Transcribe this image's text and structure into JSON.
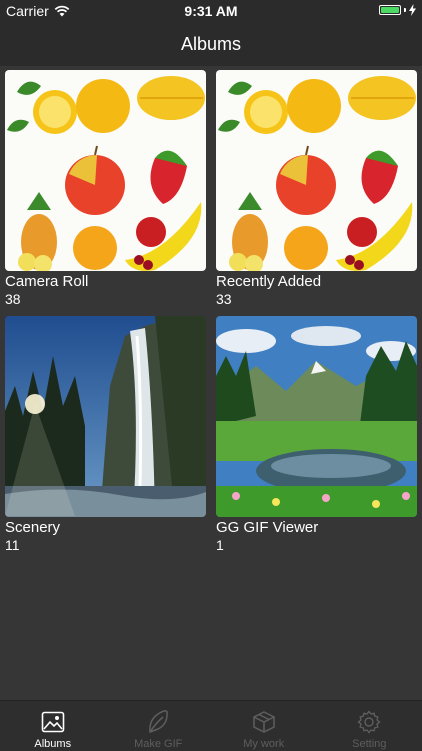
{
  "status_bar": {
    "carrier": "Carrier",
    "time": "9:31 AM"
  },
  "nav": {
    "title": "Albums"
  },
  "albums": [
    {
      "name": "Camera Roll",
      "count": "38",
      "thumb": "fruit-collage"
    },
    {
      "name": "Recently Added",
      "count": "33",
      "thumb": "fruit-collage"
    },
    {
      "name": "Scenery",
      "count": "11",
      "thumb": "waterfall-forest"
    },
    {
      "name": "GG GIF Viewer",
      "count": "1",
      "thumb": "mountain-lake"
    }
  ],
  "tabs": [
    {
      "label": "Albums",
      "icon": "photo-icon",
      "active": true
    },
    {
      "label": "Make GIF",
      "icon": "leaf-icon",
      "active": false
    },
    {
      "label": "My work",
      "icon": "box-icon",
      "active": false
    },
    {
      "label": "Setting",
      "icon": "gear-icon",
      "active": false
    }
  ],
  "colors": {
    "background": "#363636",
    "bar": "#2b2b2b",
    "battery": "#4cd964",
    "tab_inactive": "#5e5e5e"
  }
}
